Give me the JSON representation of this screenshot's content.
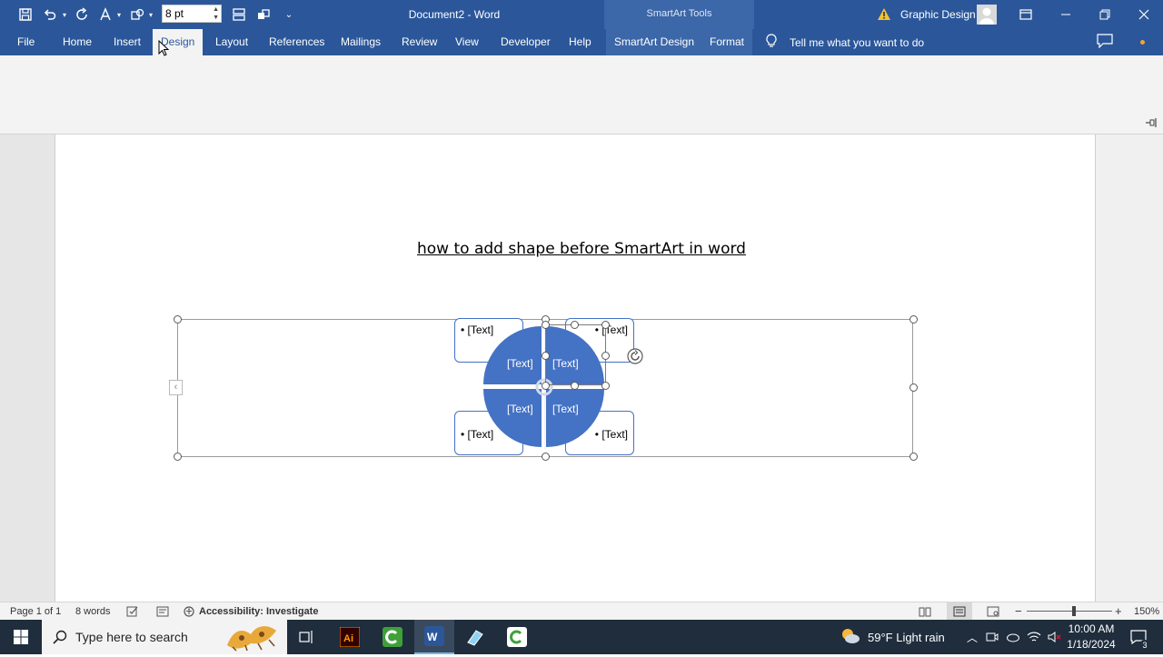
{
  "titlebar": {
    "font_size_value": "8 pt",
    "document_title": "Document2  -  Word",
    "contextual_group": "SmartArt Tools",
    "user_name": "Graphic Design"
  },
  "tabs": [
    {
      "label": "File"
    },
    {
      "label": "Home"
    },
    {
      "label": "Insert"
    },
    {
      "label": "Design"
    },
    {
      "label": "Layout"
    },
    {
      "label": "References"
    },
    {
      "label": "Mailings"
    },
    {
      "label": "Review"
    },
    {
      "label": "View"
    },
    {
      "label": "Developer"
    },
    {
      "label": "Help"
    },
    {
      "label": "SmartArt Design"
    },
    {
      "label": "Format"
    }
  ],
  "tell_me": "Tell me what you want to do",
  "document": {
    "heading": "how to add shape before SmartArt in word",
    "smartart": {
      "quadrant_labels": [
        "[Text]",
        "[Text]",
        "[Text]",
        "[Text]"
      ],
      "side_boxes": [
        "• [Text]",
        "• [Text]",
        "• [Text]",
        "• [Text]"
      ],
      "fill_color": "#4472c4"
    }
  },
  "statusbar": {
    "page": "Page 1 of 1",
    "words": "8 words",
    "accessibility": "Accessibility: Investigate",
    "zoom": "150%"
  },
  "taskbar": {
    "search_placeholder": "Type here to search",
    "weather": "59°F  Light rain",
    "time": "10:00 AM",
    "date": "1/18/2024",
    "notifications": "3"
  }
}
